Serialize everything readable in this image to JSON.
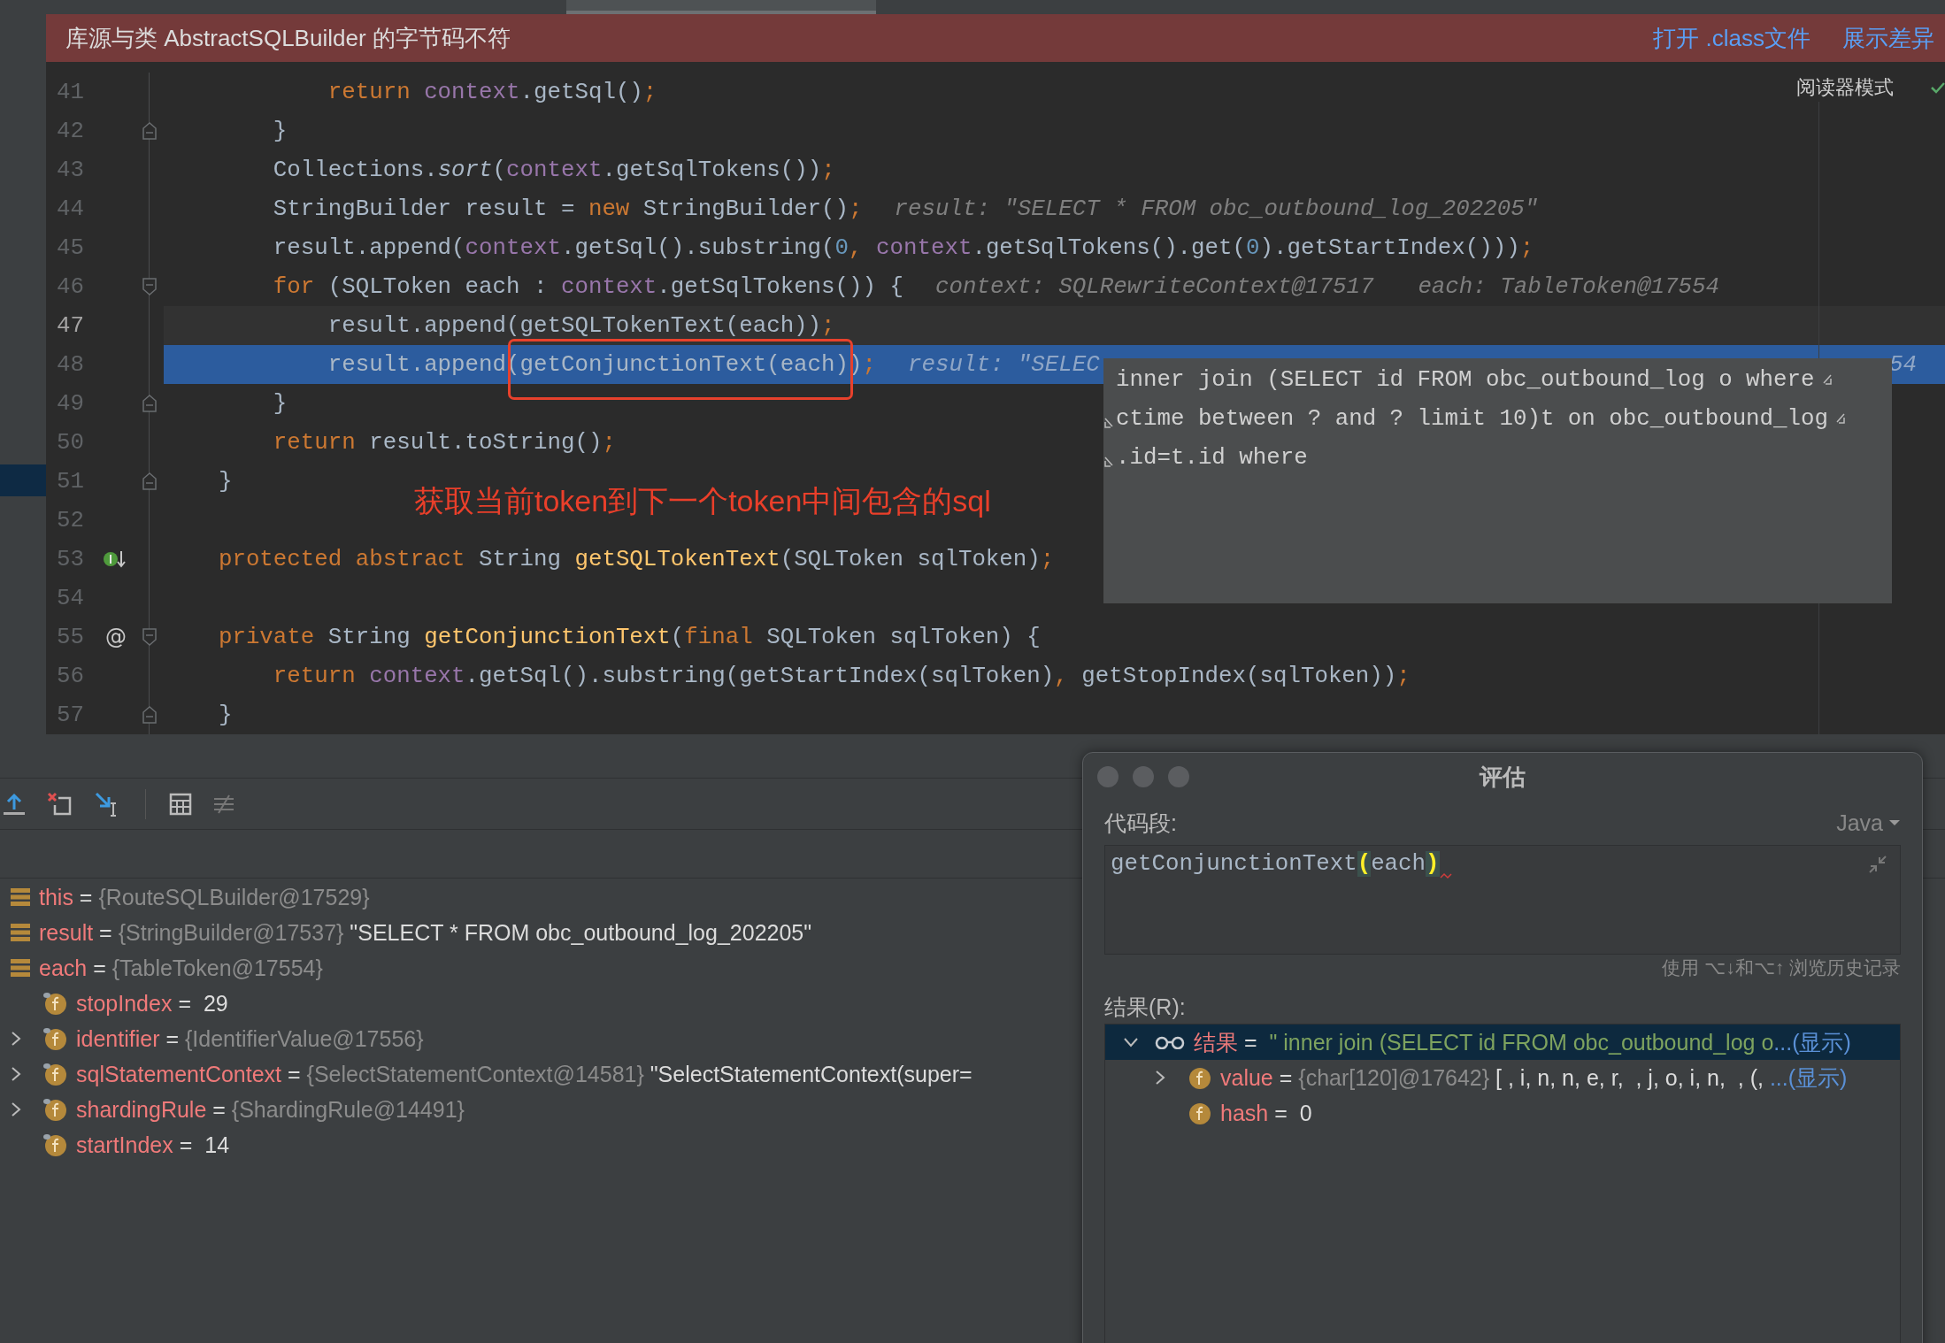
{
  "banner": {
    "message": "库源与类 AbstractSQLBuilder 的字节码不符",
    "links": [
      "打开 .class文件",
      "展示差异"
    ]
  },
  "editor": {
    "reader_mode": "阅读器模式",
    "lines": [
      {
        "num": "41",
        "kind": "plain",
        "selected": false,
        "current": false,
        "code": [
          {
            "text": "            return ",
            "kind": "kw"
          },
          {
            "text": "context",
            "kind": "fld"
          },
          {
            "text": ".getSql()",
            "kind": "t"
          },
          {
            "text": ";",
            "kind": "kw"
          }
        ]
      },
      {
        "num": "42",
        "kind": "fold-end",
        "selected": false,
        "current": false,
        "code": [
          {
            "text": "        }",
            "kind": "t"
          }
        ]
      },
      {
        "num": "43",
        "kind": "plain",
        "selected": false,
        "current": false,
        "code": [
          {
            "text": "        Collections.",
            "kind": "t"
          },
          {
            "text": "sort",
            "kind": "it"
          },
          {
            "text": "(",
            "kind": "t"
          },
          {
            "text": "context",
            "kind": "fld"
          },
          {
            "text": ".getSqlTokens())",
            "kind": "t"
          },
          {
            "text": ";",
            "kind": "kw"
          }
        ]
      },
      {
        "num": "44",
        "kind": "plain",
        "selected": false,
        "current": false,
        "code": [
          {
            "text": "        StringBuilder result = ",
            "kind": "t"
          },
          {
            "text": "new",
            "kind": "kw"
          },
          {
            "text": " StringBuilder()",
            "kind": "t"
          },
          {
            "text": ";",
            "kind": "kw"
          }
        ],
        "hints": [
          "result: \"SELECT * FROM obc_outbound_log_202205\""
        ]
      },
      {
        "num": "45",
        "kind": "plain",
        "selected": false,
        "current": false,
        "code": [
          {
            "text": "        result.append(",
            "kind": "t"
          },
          {
            "text": "context",
            "kind": "fld"
          },
          {
            "text": ".getSql().substring(",
            "kind": "t"
          },
          {
            "text": "0",
            "kind": "num"
          },
          {
            "text": ", ",
            "kind": "kw"
          },
          {
            "text": "context",
            "kind": "fld"
          },
          {
            "text": ".getSqlTokens().get(",
            "kind": "t"
          },
          {
            "text": "0",
            "kind": "num"
          },
          {
            "text": ").getStartIndex()))",
            "kind": "t"
          },
          {
            "text": ";",
            "kind": "kw"
          }
        ]
      },
      {
        "num": "46",
        "kind": "fold-start",
        "selected": false,
        "current": false,
        "code": [
          {
            "text": "        for",
            "kind": "kw"
          },
          {
            "text": " (SQLToken each : ",
            "kind": "t"
          },
          {
            "text": "context",
            "kind": "fld"
          },
          {
            "text": ".getSqlTokens()) {",
            "kind": "t"
          }
        ],
        "hints": [
          "context: SQLRewriteContext@17517",
          "each: TableToken@17554"
        ]
      },
      {
        "num": "47",
        "kind": "plain",
        "selected": false,
        "current": true,
        "code": [
          {
            "text": "            result.append(getSQLTokenText(each))",
            "kind": "t"
          },
          {
            "text": ";",
            "kind": "kw"
          }
        ]
      },
      {
        "num": "48",
        "kind": "plain",
        "selected": true,
        "current": false,
        "code": [
          {
            "text": "            result.append(getConjunctionText(each))",
            "kind": "t"
          },
          {
            "text": ";",
            "kind": "kw"
          }
        ],
        "hints": [
          "result: \"SELEC"
        ],
        "far_hint": "54"
      },
      {
        "num": "49",
        "kind": "fold-end",
        "selected": false,
        "current": false,
        "code": [
          {
            "text": "        }",
            "kind": "t"
          }
        ]
      },
      {
        "num": "50",
        "kind": "plain",
        "selected": false,
        "current": false,
        "code": [
          {
            "text": "        return",
            "kind": "kw"
          },
          {
            "text": " result.toString()",
            "kind": "t"
          },
          {
            "text": ";",
            "kind": "kw"
          }
        ]
      },
      {
        "num": "51",
        "kind": "fold-end",
        "selected": false,
        "current": false,
        "code": [
          {
            "text": "    }",
            "kind": "t"
          }
        ]
      },
      {
        "num": "52",
        "kind": "plain",
        "selected": false,
        "current": false
      },
      {
        "num": "53",
        "kind": "plain",
        "selected": false,
        "current": false,
        "gutter": {
          "kind": "implemented"
        },
        "code": [
          {
            "text": "    protected abstract",
            "kind": "kw"
          },
          {
            "text": " String ",
            "kind": "t"
          },
          {
            "text": "getSQLTokenText",
            "kind": "fn"
          },
          {
            "text": "(SQLToken sqlToken)",
            "kind": "t"
          },
          {
            "text": ";",
            "kind": "kw"
          }
        ]
      },
      {
        "num": "54",
        "kind": "plain",
        "selected": false,
        "current": false
      },
      {
        "num": "55",
        "kind": "fold-start",
        "selected": false,
        "current": false,
        "gutter": {
          "kind": "text",
          "text": "@"
        },
        "code": [
          {
            "text": "    private",
            "kind": "kw"
          },
          {
            "text": " String ",
            "kind": "t"
          },
          {
            "text": "getConjunctionText",
            "kind": "fn"
          },
          {
            "text": "(",
            "kind": "t"
          },
          {
            "text": "final",
            "kind": "kw"
          },
          {
            "text": " SQLToken sqlToken) {",
            "kind": "t"
          }
        ]
      },
      {
        "num": "56",
        "kind": "plain",
        "selected": false,
        "current": false,
        "code": [
          {
            "text": "        return ",
            "kind": "kw"
          },
          {
            "text": "context",
            "kind": "fld"
          },
          {
            "text": ".getSql().substring(getStartIndex(sqlToken)",
            "kind": "t"
          },
          {
            "text": ",",
            "kind": "kw"
          },
          {
            "text": " getStopIndex(sqlToken))",
            "kind": "t"
          },
          {
            "text": ";",
            "kind": "kw"
          }
        ]
      },
      {
        "num": "57",
        "kind": "fold-end",
        "selected": false,
        "current": false,
        "code": [
          {
            "text": "    }",
            "kind": "t"
          }
        ]
      }
    ],
    "annotation": "获取当前token到下一个token中间包含的sql",
    "tooltip": {
      "lines": [
        {
          "text": "inner join (SELECT id FROM obc_outbound_log o where",
          "wrap_before": false,
          "wrap_after": true
        },
        {
          "text": "ctime between ? and ? limit 10)t on obc_outbound_log",
          "wrap_before": true,
          "wrap_after": true
        },
        {
          "text": ".id=t.id where",
          "wrap_before": true,
          "wrap_after": false
        }
      ]
    }
  },
  "debugger": {
    "variables": [
      {
        "kind": "local",
        "name": "this",
        "operator": "=",
        "ref": "{RouteSQLBuilder@17529}"
      },
      {
        "kind": "local",
        "name": "result",
        "operator": "=",
        "ref": "{StringBuilder@17537}",
        "text": "\"SELECT * FROM obc_outbound_log_202205\""
      },
      {
        "kind": "local",
        "name": "each",
        "operator": "=",
        "ref": "{TableToken@17554}",
        "children": [
          {
            "kind": "field",
            "name": "stopIndex",
            "operator": "=",
            "text": "29"
          },
          {
            "kind": "field",
            "expanded": false,
            "name": "identifier",
            "operator": "=",
            "ref": "{IdentifierValue@17556}"
          },
          {
            "kind": "field",
            "expanded": false,
            "name": "sqlStatementContext",
            "operator": "=",
            "ref": "{SelectStatementContext@14581}",
            "text": "\"SelectStatementContext(super="
          },
          {
            "kind": "field",
            "expanded": false,
            "name": "shardingRule",
            "operator": "=",
            "ref": "{ShardingRule@14491}"
          },
          {
            "kind": "field",
            "name": "startIndex",
            "operator": "=",
            "text": "14"
          }
        ]
      }
    ]
  },
  "evaluate_dialog": {
    "title": "评估",
    "code_label": "代码段:",
    "language": "Java",
    "code": [
      {
        "text": "getConjunctionText",
        "kind": "t"
      },
      {
        "text": "(",
        "kind": "match"
      },
      {
        "text": "each",
        "kind": "t"
      },
      {
        "text": ")",
        "kind": "match"
      }
    ],
    "history_hint": "使用 ⌥↓和⌥↑ 浏览历史记录",
    "result_label": "结果(R):",
    "results": [
      {
        "kind": "watch",
        "expanded": true,
        "selected": true,
        "name": "结果",
        "operator": "=",
        "string": "\" inner join (SELECT id FROM obc_outbound_log o",
        "more": "...(显示)",
        "children": [
          {
            "kind": "field",
            "expanded": false,
            "selected": false,
            "name": "value",
            "operator": "=",
            "ref": "{char[120]@17642}",
            "text": "[ , i, n, n, e, r,  , j, o, i, n,  , (, ",
            "more": "...(显示)"
          },
          {
            "kind": "field",
            "selected": false,
            "name": "hash",
            "operator": "=",
            "text": "0"
          }
        ]
      }
    ]
  }
}
